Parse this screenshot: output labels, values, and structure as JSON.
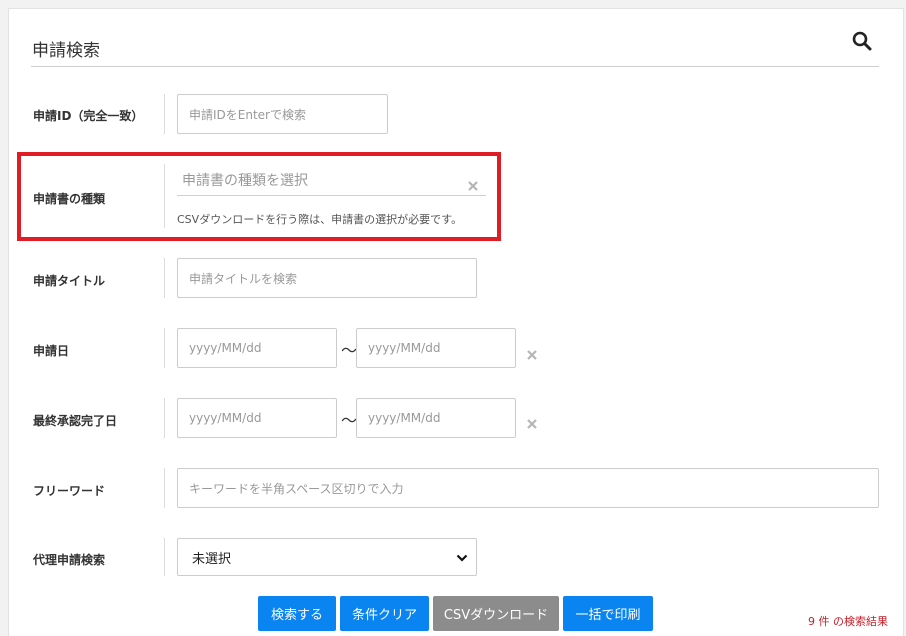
{
  "header": {
    "title": "申請検索",
    "search_icon": "search-icon"
  },
  "fields": {
    "application_id": {
      "label": "申請ID（完全一致）",
      "placeholder": "申請IDをEnterで検索"
    },
    "document_type": {
      "label": "申請書の種類",
      "placeholder": "申請書の種類を選択",
      "help": "CSVダウンロードを行う際は、申請書の選択が必要です。"
    },
    "application_title": {
      "label": "申請タイトル",
      "placeholder": "申請タイトルを検索"
    },
    "application_date": {
      "label": "申請日",
      "from_placeholder": "yyyy/MM/dd",
      "to_placeholder": "yyyy/MM/dd",
      "separator": "〜"
    },
    "final_approval_date": {
      "label": "最終承認完了日",
      "from_placeholder": "yyyy/MM/dd",
      "to_placeholder": "yyyy/MM/dd",
      "separator": "〜"
    },
    "free_word": {
      "label": "フリーワード",
      "placeholder": "キーワードを半角スペース区切りで入力"
    },
    "proxy_search": {
      "label": "代理申請検索",
      "selected": "未選択"
    }
  },
  "buttons": {
    "search": "検索する",
    "clear": "条件クリア",
    "csv": "CSVダウンロード",
    "print": "一括で印刷"
  },
  "results": {
    "count": "9",
    "unit": "件",
    "suffix": "の検索結果"
  },
  "colors": {
    "primary": "#0a84f0",
    "disabled": "#8c8c8c",
    "highlight": "#e01d25",
    "result_text": "#c6202b"
  }
}
